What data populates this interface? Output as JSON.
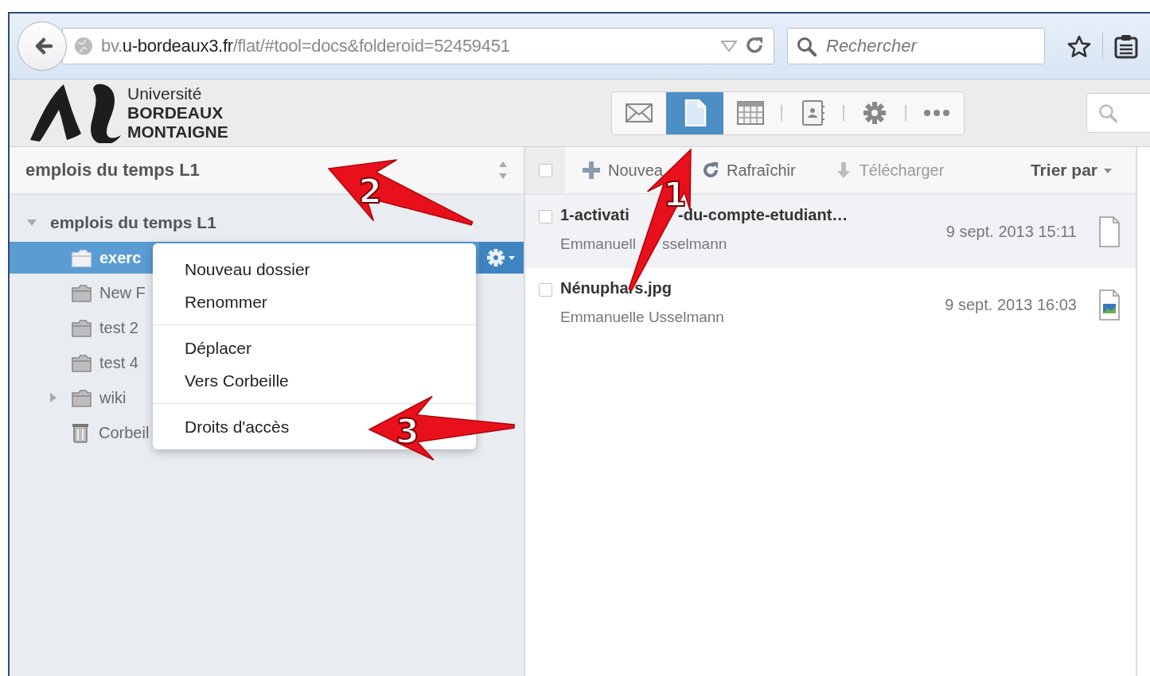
{
  "browser": {
    "address": {
      "prefix": "bv.",
      "domain": "u-bordeaux3.fr",
      "path": "/flat/#tool=docs&folderoid=52459451"
    },
    "search": {
      "placeholder": "Rechercher"
    }
  },
  "logo": {
    "lines": [
      "Université",
      "BORDEAUX",
      "MONTAIGNE"
    ]
  },
  "app_tabs": [
    {
      "kind": "mail",
      "selected": false
    },
    {
      "kind": "documents",
      "selected": true
    },
    {
      "kind": "calendar",
      "selected": false
    },
    {
      "kind": "contacts",
      "selected": false
    },
    {
      "kind": "settings",
      "selected": false
    },
    {
      "kind": "more",
      "selected": false
    }
  ],
  "sidebar": {
    "title": "emplois du temps L1",
    "tree": [
      {
        "label": "emplois du temps L1",
        "kind": "root",
        "expanded": true,
        "selected": false,
        "children": [
          {
            "label": "exerc",
            "kind": "folder",
            "selected": true
          },
          {
            "label": "New F",
            "kind": "folder",
            "selected": false
          },
          {
            "label": "test 2",
            "kind": "folder",
            "selected": false
          },
          {
            "label": "test 4",
            "kind": "folder",
            "selected": false
          },
          {
            "label": "wiki",
            "kind": "folder",
            "expanded": false,
            "selected": false
          },
          {
            "label": "Corbeil",
            "kind": "trash",
            "selected": false
          }
        ]
      }
    ]
  },
  "context_menu": {
    "groups": [
      [
        "Nouveau dossier",
        "Renommer"
      ],
      [
        "Déplacer",
        "Vers Corbeille"
      ],
      [
        "Droits d'accès"
      ]
    ]
  },
  "toolbar": {
    "select_all": {
      "checked": false
    },
    "actions": [
      {
        "kind": "new",
        "label": "Nouvea",
        "disabled": false
      },
      {
        "kind": "refresh",
        "label": "Rafraîchir",
        "disabled": false
      },
      {
        "kind": "download",
        "label": "Télécharger",
        "disabled": true
      }
    ],
    "sort": "Trier par"
  },
  "files": [
    {
      "name": [
        "1-activati",
        "-du-compte-etudiant…"
      ],
      "author": [
        "Emmanuell",
        "sselmann"
      ],
      "date": "9 sept. 2013 15:11",
      "kind": "document",
      "selected": true,
      "checked": false
    },
    {
      "name": [
        "Nénuphars.jpg"
      ],
      "author": [
        "Emmanuelle Usselmann"
      ],
      "date": "9 sept. 2013 16:03",
      "kind": "image",
      "selected": false,
      "checked": false
    }
  ],
  "annotations": [
    {
      "label": "1"
    },
    {
      "label": "2"
    },
    {
      "label": "3"
    }
  ]
}
